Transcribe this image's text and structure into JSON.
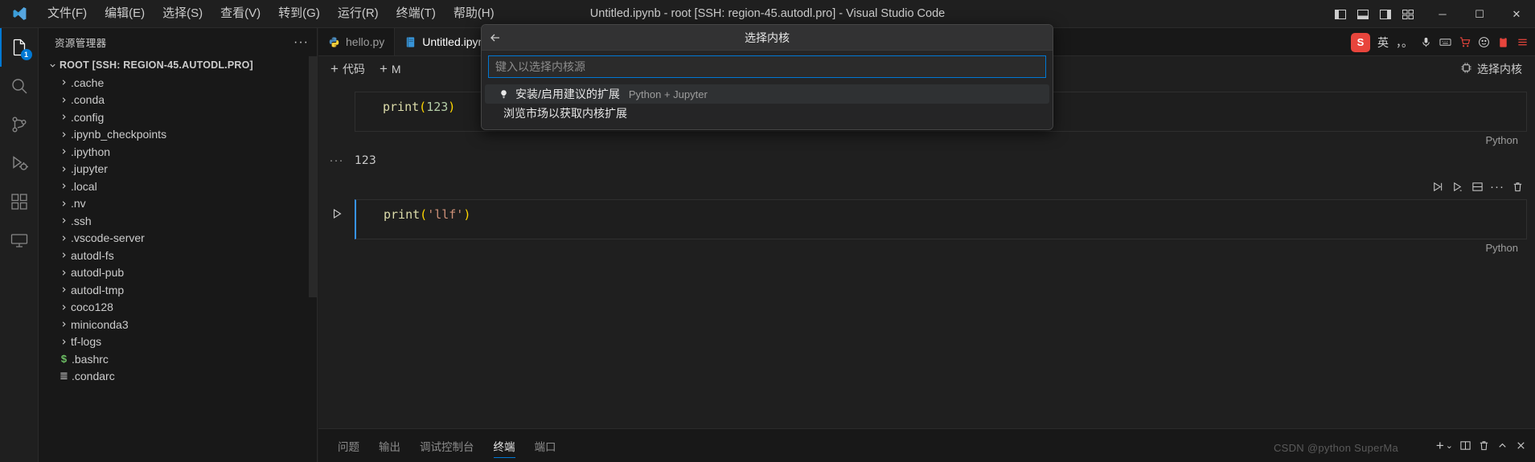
{
  "window": {
    "title": "Untitled.ipynb - root [SSH: region-45.autodl.pro] - Visual Studio Code",
    "minimize_label": "─",
    "maximize_label": "☐",
    "close_label": "✕"
  },
  "menu": {
    "items": [
      {
        "label": "文件(F)",
        "name": "menu-file"
      },
      {
        "label": "编辑(E)",
        "name": "menu-edit"
      },
      {
        "label": "选择(S)",
        "name": "menu-selection"
      },
      {
        "label": "查看(V)",
        "name": "menu-view"
      },
      {
        "label": "转到(G)",
        "name": "menu-goto"
      },
      {
        "label": "运行(R)",
        "name": "menu-run"
      },
      {
        "label": "终端(T)",
        "name": "menu-terminal"
      },
      {
        "label": "帮助(H)",
        "name": "menu-help"
      }
    ]
  },
  "activitybar": {
    "items": [
      {
        "icon": "files-explorer-icon",
        "badge": "1",
        "active": true
      },
      {
        "icon": "search-icon",
        "badge": "",
        "active": false
      },
      {
        "icon": "source-control-icon",
        "badge": "",
        "active": false
      },
      {
        "icon": "run-and-debug-icon",
        "badge": "",
        "active": false
      },
      {
        "icon": "extensions-icon",
        "badge": "",
        "active": false
      },
      {
        "icon": "remote-explorer-icon",
        "badge": "",
        "active": false
      }
    ]
  },
  "sidebar": {
    "header": "资源管理器",
    "more_actions": "···",
    "root_label": "ROOT [SSH: REGION-45.AUTODL.PRO]",
    "items": [
      {
        "label": ".cache",
        "type": "folder"
      },
      {
        "label": ".conda",
        "type": "folder"
      },
      {
        "label": ".config",
        "type": "folder"
      },
      {
        "label": ".ipynb_checkpoints",
        "type": "folder"
      },
      {
        "label": ".ipython",
        "type": "folder"
      },
      {
        "label": ".jupyter",
        "type": "folder"
      },
      {
        "label": ".local",
        "type": "folder"
      },
      {
        "label": ".nv",
        "type": "folder"
      },
      {
        "label": ".ssh",
        "type": "folder"
      },
      {
        "label": ".vscode-server",
        "type": "folder"
      },
      {
        "label": "autodl-fs",
        "type": "folder"
      },
      {
        "label": "autodl-pub",
        "type": "folder"
      },
      {
        "label": "autodl-tmp",
        "type": "folder"
      },
      {
        "label": "coco128",
        "type": "folder"
      },
      {
        "label": "miniconda3",
        "type": "folder"
      },
      {
        "label": "tf-logs",
        "type": "folder"
      },
      {
        "label": ".bashrc",
        "type": "shell-file"
      },
      {
        "label": ".condarc",
        "type": "config-file"
      }
    ]
  },
  "editor": {
    "tabs": [
      {
        "label": "hello.py",
        "icon": "python-file-icon",
        "active": false
      },
      {
        "label": "Untitled.ipynb",
        "icon": "notebook-file-icon",
        "active": true
      }
    ],
    "toolbar": {
      "add_code_label": "代码",
      "add_markdown_label": "M",
      "plus": "+",
      "select_kernel_label": "选择内核"
    },
    "cells": [
      {
        "code": "print(123)",
        "language": "Python",
        "output": "123",
        "output_dots": "···"
      },
      {
        "code": "print('llf')",
        "language": "Python",
        "output": "",
        "output_dots": ""
      }
    ],
    "cell_toolbar": {
      "run_label": "run-cell",
      "run_below_label": "run-below",
      "split_label": "split-cell",
      "more_label": "···",
      "delete_label": "delete-cell"
    }
  },
  "ime": {
    "logo": "S",
    "mode": "英",
    "punct": "，。",
    "items": [
      "mic-icon",
      "keyboard-icon",
      "cart-icon",
      "emoji-icon",
      "clipboard-icon",
      "menu-icon"
    ]
  },
  "quickpick": {
    "title": "选择内核",
    "back_label": "←",
    "input_placeholder": "键入以选择内核源",
    "input_value": "",
    "items": [
      {
        "label": "安装/启用建议的扩展",
        "description": "Python + Jupyter",
        "icon": "lightbulb-icon",
        "selected": true
      },
      {
        "label": "浏览市场以获取内核扩展",
        "description": "",
        "icon": "",
        "selected": false
      }
    ]
  },
  "panel": {
    "tabs": [
      {
        "label": "问题",
        "active": false
      },
      {
        "label": "输出",
        "active": false
      },
      {
        "label": "调试控制台",
        "active": false
      },
      {
        "label": "终端",
        "active": true
      },
      {
        "label": "端口",
        "active": false
      }
    ],
    "new_terminal": "+",
    "chevron": "⌄",
    "watermark": "CSDN @python SuperMa"
  },
  "colors": {
    "accent": "#0078d4",
    "bg": "#1f1f1f",
    "sidebar_bg": "#181818",
    "quickpick_bg": "#252526"
  }
}
